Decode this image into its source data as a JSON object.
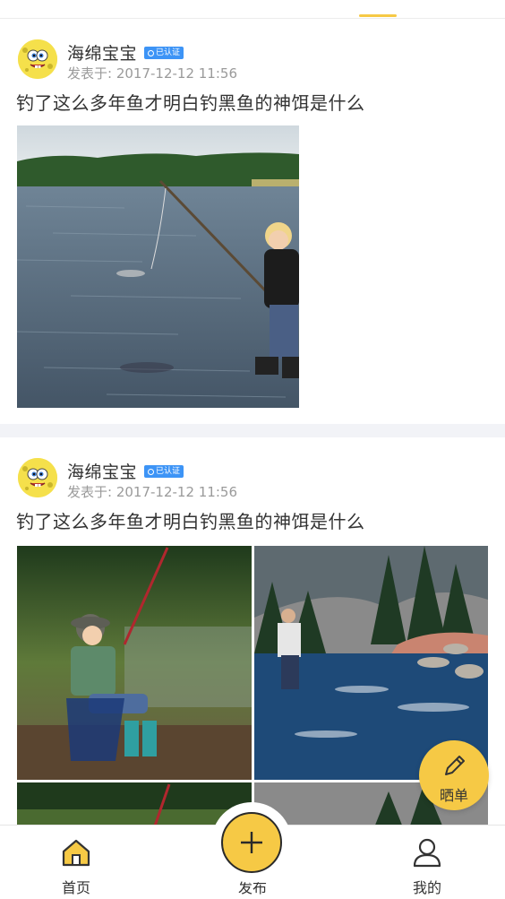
{
  "feed": {
    "posts": [
      {
        "username": "海绵宝宝",
        "badge": "已认证",
        "timestamp": "发表于: 2017-12-12 11:56",
        "title": "钓了这么多年鱼才明白钓黑鱼的神饵是什么",
        "images": [
          "boy-fishing-with-stick-photo"
        ]
      },
      {
        "username": "海绵宝宝",
        "badge": "已认证",
        "timestamp": "发表于: 2017-12-12 11:56",
        "title": "钓了这么多年鱼才明白钓黑鱼的神饵是什么",
        "images": [
          "kid-on-chair-fishing-photo",
          "man-fishing-in-river-photo",
          "kid-fishing-photo-partial",
          "river-photo-partial"
        ]
      }
    ]
  },
  "fab": {
    "label": "晒单",
    "icon": "pencil-icon"
  },
  "tabbar": {
    "home": {
      "label": "首页",
      "icon": "home-icon"
    },
    "publish": {
      "label": "发布",
      "icon": "plus-icon"
    },
    "mine": {
      "label": "我的",
      "icon": "user-icon"
    }
  },
  "colors": {
    "accent": "#f6c945",
    "badge": "#3d94f6",
    "separator": "#f2f3f7"
  }
}
